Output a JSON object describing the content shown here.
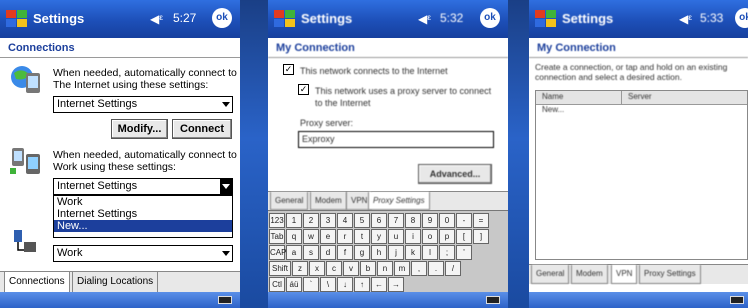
{
  "screen1": {
    "title": "Settings",
    "time": "5:27",
    "ok_label": "ok",
    "header": "Connections",
    "internet_text": "When needed, automatically connect to The Internet using these settings:",
    "internet_select": "Internet Settings",
    "modify_label": "Modify...",
    "connect_label": "Connect",
    "work_text": "When needed, automatically connect to Work using these settings:",
    "work_select": "Internet Settings",
    "work_options": [
      "Work",
      "Internet Settings",
      "New..."
    ],
    "bottom_select": "Work",
    "tabs": [
      "Connections",
      "Dialing Locations"
    ]
  },
  "screen2": {
    "title": "Settings",
    "time": "5:32",
    "header": "My Connection",
    "check1_label": "This network connects to the Internet",
    "check2_label": "This network uses a proxy server to connect to the Internet",
    "proxy_label": "Proxy server:",
    "proxy_value": "Exproxy",
    "advanced_label": "Advanced...",
    "tabs": [
      "General",
      "Modem",
      "VPN",
      "Proxy Settings"
    ],
    "keys_row1": [
      "123",
      "1",
      "2",
      "3",
      "4",
      "5",
      "6",
      "7",
      "8",
      "9",
      "0",
      "-",
      "="
    ],
    "keys_row2": [
      "Tab",
      "q",
      "w",
      "e",
      "r",
      "t",
      "y",
      "u",
      "i",
      "o",
      "p",
      "[",
      "]"
    ],
    "keys_row3": [
      "CAP",
      "a",
      "s",
      "d",
      "f",
      "g",
      "h",
      "j",
      "k",
      "l",
      ";",
      "'"
    ],
    "keys_row4": [
      "Shift",
      "z",
      "x",
      "c",
      "v",
      "b",
      "n",
      "m",
      ",",
      ".",
      "/"
    ],
    "keys_row5": [
      "Ctl",
      "áü",
      "`",
      "\\",
      "↓",
      "↑",
      "←",
      "→"
    ]
  },
  "screen3": {
    "title": "Settings",
    "time": "5:33",
    "header": "My Connection",
    "desc": "Create a connection, or tap and hold on an existing connection and select a desired action.",
    "col_name": "Name",
    "col_server": "Server",
    "row1": "New...",
    "tabs": [
      "General",
      "Modem",
      "VPN",
      "Proxy Settings"
    ]
  },
  "colors": {
    "titlebar": "#1d4fb8",
    "header_text": "#1c3f9c",
    "selection": "#1c3f9c"
  }
}
